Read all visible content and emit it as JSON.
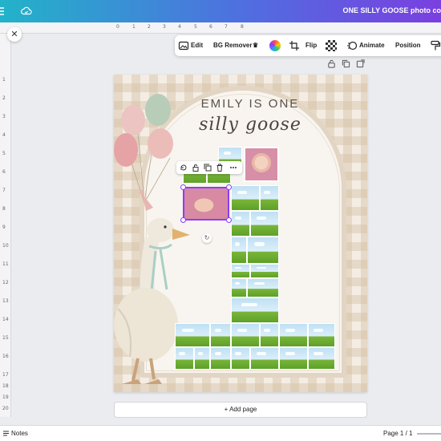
{
  "window": {
    "doc_title": "ONE SILLY GOOSE photo co"
  },
  "ruler": {
    "top_ticks": [
      "0",
      "1",
      "2",
      "3",
      "4",
      "5",
      "6",
      "7",
      "8"
    ],
    "left_ticks": [
      "1",
      "2",
      "3",
      "4",
      "5",
      "6",
      "7",
      "8",
      "9",
      "10",
      "11",
      "12",
      "13",
      "14",
      "15",
      "16",
      "17",
      "18",
      "19",
      "20"
    ]
  },
  "toolbar": {
    "edit_label": "Edit",
    "bg_remover_label": "BG Remover",
    "flip_label": "Flip",
    "animate_label": "Animate",
    "position_label": "Position"
  },
  "canvas": {
    "heading": "EMILY IS ONE",
    "script_heading": "silly goose"
  },
  "add_page_label": "+ Add page",
  "status": {
    "notes_label": "Notes",
    "page_label": "Page 1 / 1"
  },
  "colors": {
    "accent": "#8b3dff",
    "header_gradient_start": "#22b3c9",
    "header_gradient_end": "#7a3fe0",
    "gingham": "#d4c1a6",
    "arch_border": "#e3d5c3",
    "grass": "#79b63a",
    "sky": "#bfe0f4"
  },
  "icons": {
    "close": "close-icon",
    "cloud": "cloud-saved-icon",
    "edit": "edit-image-icon",
    "crop": "crop-icon",
    "transparency": "transparency-icon",
    "animate": "animate-icon",
    "format": "paint-roller-icon"
  }
}
